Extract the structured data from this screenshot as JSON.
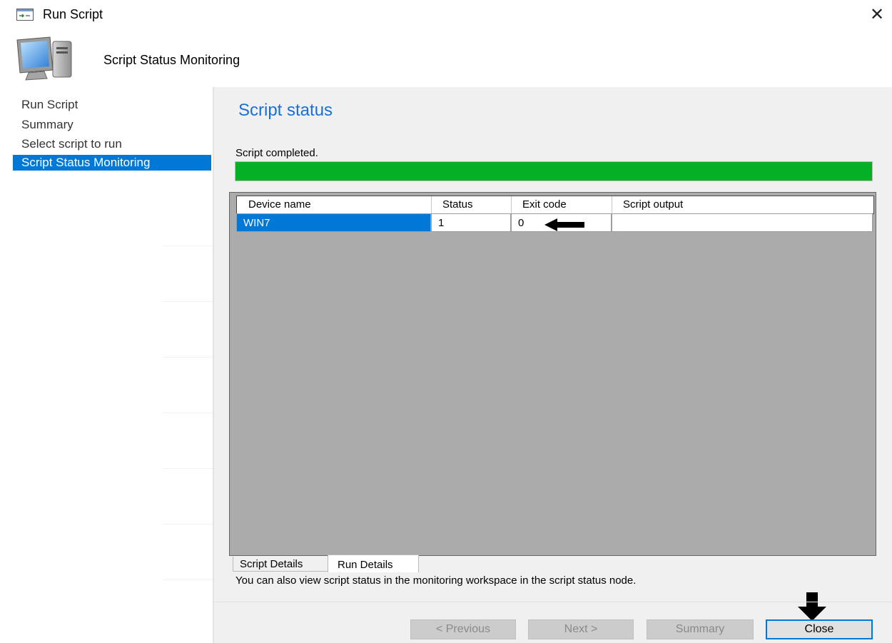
{
  "window": {
    "title": "Run Script",
    "close_glyph": "✕"
  },
  "header": {
    "title": "Script Status Monitoring"
  },
  "nav": {
    "items": [
      {
        "label": "Run Script"
      },
      {
        "label": "Summary"
      },
      {
        "label": "Select script to run"
      },
      {
        "label": "Script Status Monitoring",
        "selected": true
      }
    ]
  },
  "main": {
    "heading": "Script status",
    "status_text": "Script completed.",
    "progress_fraction": 1.0,
    "table": {
      "columns": [
        "Device name",
        "Status",
        "Exit code",
        "Script output"
      ],
      "rows": [
        {
          "device": "WIN7",
          "status": "1",
          "exit_code": "0",
          "output": ""
        }
      ]
    },
    "tabs": [
      "Script Details",
      "Run Details"
    ],
    "info": "You can also view script status in the monitoring workspace in the script status node."
  },
  "footer": {
    "previous_label": "< Previous",
    "next_label": "Next >",
    "summary_label": "Summary",
    "close_label": "Close"
  },
  "colors": {
    "accent": "#0078d7",
    "progress": "#06b025",
    "heading": "#1a6fd6"
  },
  "icons": {
    "title": "run-script-icon",
    "header": "computer-icon",
    "annotation_1": "arrow-left-icon",
    "annotation_2": "arrow-down-icon"
  }
}
